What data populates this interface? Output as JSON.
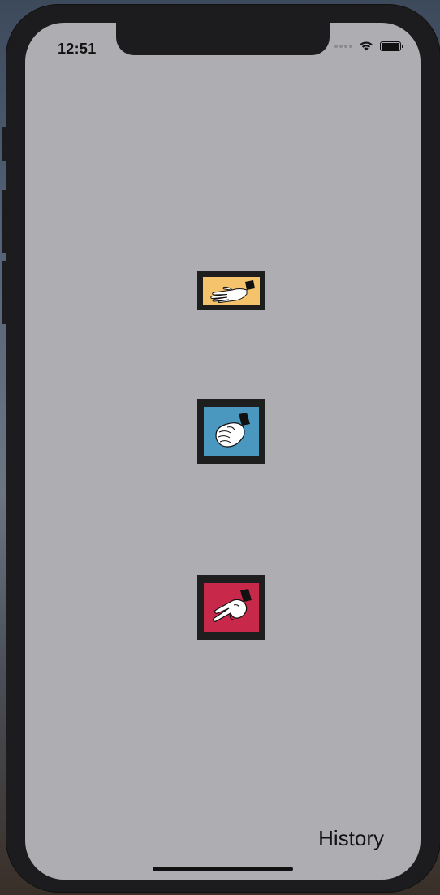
{
  "status_bar": {
    "time": "12:51",
    "icons": [
      "signal-dots-icon",
      "wifi-icon",
      "battery-icon"
    ]
  },
  "choices": [
    {
      "name": "paper",
      "icon": "open-hand-icon",
      "color": "#f5c36b"
    },
    {
      "name": "rock",
      "icon": "fist-icon",
      "color": "#4a97bf"
    },
    {
      "name": "scissors",
      "icon": "two-fingers-hand-icon",
      "color": "#c8294b"
    }
  ],
  "footer": {
    "history_label": "History"
  },
  "colors": {
    "screen_background": "#aeadb2",
    "frame": "#1c1c1e",
    "card_border": "#1e1e1e"
  }
}
